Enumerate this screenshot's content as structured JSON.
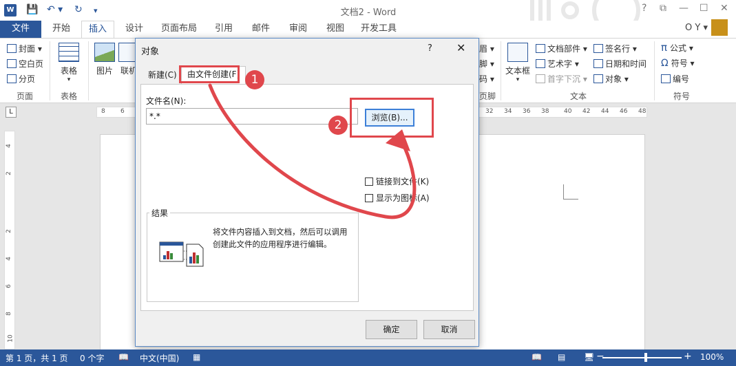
{
  "window": {
    "app_icon": "W",
    "title": "文档2 - Word",
    "controls": {
      "help": "?",
      "restore": "⧉",
      "minimize": "—",
      "maximize": "☐",
      "close": "✕"
    },
    "user": "O Y ▾"
  },
  "tabs": {
    "file": "文件",
    "items": [
      "开始",
      "插入",
      "设计",
      "页面布局",
      "引用",
      "邮件",
      "审阅",
      "视图",
      "开发工具"
    ],
    "active": "插入"
  },
  "ribbon": {
    "pages": {
      "items": [
        "封面 ▾",
        "空白页",
        "分页"
      ],
      "group": "页面"
    },
    "tables": {
      "label": "表格",
      "group": "表格"
    },
    "illustrations": {
      "picture": "图片",
      "online": "联机"
    },
    "header_footer": {
      "partial": [
        "眉 ▾",
        "脚 ▾",
        "码 ▾"
      ],
      "group": "页脚"
    },
    "text": {
      "textbox": "文本框",
      "items": [
        "文档部件 ▾",
        "艺术字 ▾",
        "首字下沉 ▾",
        "签名行 ▾",
        "日期和时间",
        "对象 ▾"
      ],
      "group": "文本"
    },
    "symbols": {
      "items": [
        "公式 ▾",
        "符号 ▾",
        "编号"
      ],
      "group": "符号"
    }
  },
  "ruler": {
    "corner": "L",
    "left_numbers": [
      "8",
      "6"
    ],
    "right_numbers": [
      "32",
      "34",
      "36",
      "38",
      "40",
      "42",
      "44",
      "46",
      "48"
    ],
    "vertical_numbers": [
      "4",
      "2",
      "2",
      "4",
      "6",
      "8",
      "10"
    ]
  },
  "dialog": {
    "title": "对象",
    "help": "?",
    "close": "✕",
    "tabs": [
      "新建(C)",
      "由文件创建(F)"
    ],
    "file_name_label": "文件名(N):",
    "file_name_value": "*.*",
    "browse_label": "浏览(B)...",
    "link_label": "链接到文件(K)",
    "icon_label": "显示为图标(A)",
    "result_legend": "结果",
    "result_text": "将文件内容插入到文档，然后可以调用创建此文件的应用程序进行编辑。",
    "ok": "确定",
    "cancel": "取消"
  },
  "annotations": {
    "step1": "1",
    "step2": "2",
    "color": "#e0474c"
  },
  "statusbar": {
    "page": "第 1 页，共 1 页",
    "words": "0 个字",
    "language": "中文(中国)",
    "zoom_out": "−",
    "zoom_in": "+",
    "zoom": "100%"
  },
  "colors": {
    "accent": "#2b579a",
    "dialog_border": "#5b8ac5",
    "browse_focus": "#3c7fd8"
  }
}
